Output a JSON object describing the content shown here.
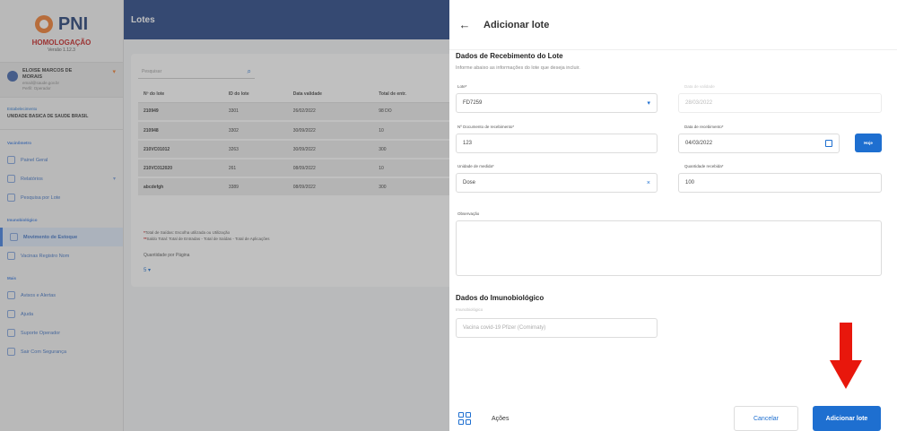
{
  "sidebar": {
    "app_name": "PNI",
    "environment": "HOMOLOGAÇÃO",
    "version": "Versão 1.12.3",
    "user": {
      "name_line1": "ELOISE MARCOS DE",
      "name_line2": "MORAIS",
      "sub_line1": "email@saude.gov.br",
      "sub_line2": "Perfil: Operador"
    },
    "establishment": {
      "label": "Estabelecimento",
      "name": "UNIDADE BASICA DE SAUDE BRASIL"
    },
    "sections": [
      {
        "title": "Vacinômetro",
        "items": [
          {
            "label": "Painel Geral",
            "icon": "chart-icon"
          },
          {
            "label": "Relatórios",
            "icon": "report-icon",
            "has_caret": true
          },
          {
            "label": "Pesquisa por Lote",
            "icon": "search-icon"
          }
        ]
      },
      {
        "title": "Imunobiológico",
        "items": [
          {
            "label": "Movimento de Estoque",
            "icon": "stock-icon",
            "active": true
          },
          {
            "label": "Vacinas Registro Nom",
            "icon": "person-icon"
          }
        ]
      },
      {
        "title": "Mais",
        "items": [
          {
            "label": "Avisos e Alertas",
            "icon": "bell-icon"
          },
          {
            "label": "Ajuda",
            "icon": "help-icon"
          },
          {
            "label": "Suporte Operador",
            "icon": "support-icon"
          },
          {
            "label": "Sair Com Segurança",
            "icon": "logout-icon"
          }
        ]
      }
    ]
  },
  "main": {
    "title": "Lotes",
    "search_placeholder": "Pesquisar",
    "columns": [
      "Nº do lote",
      "ID do lote",
      "Data validade",
      "Total de entr."
    ],
    "rows": [
      [
        "210949",
        "3301",
        "26/02/2022",
        "98 DO"
      ],
      [
        "210948",
        "3302",
        "30/09/2022",
        "10"
      ],
      [
        "210VC01012",
        "3263",
        "30/09/2022",
        "300"
      ],
      [
        "210VC012020",
        "261",
        "08/09/2022",
        "10"
      ],
      [
        "abcdefgh",
        "3389",
        "08/09/2022",
        "300"
      ]
    ],
    "note1_prefix": "*",
    "note1": "Total de Saídas: Escolha utilizada ou Utilização",
    "note2_prefix": "**",
    "note2": "Saldo Total: Total de Entradas - Total de Saídas - Total de Aplicações",
    "per_page_label": "Quantidade por Página",
    "per_page_value": "5 ▾"
  },
  "drawer": {
    "title": "Adicionar lote",
    "section1_title": "Dados de Recebimento do Lote",
    "section1_sub": "Informe abaixo as informações do lote que deseja incluir.",
    "fields": {
      "lote_label": "Lote*",
      "lote_value": "FD7259",
      "validade_label": "Data de validade",
      "validade_value": "28/03/2022",
      "documento_label": "Nº Documento de recebimento*",
      "documento_value": "123",
      "recebimento_label": "Data de recebimento*",
      "recebimento_value": "04/03/2022",
      "hoje_label": "Hoje",
      "unidade_label": "Unidade de medida*",
      "unidade_value": "Dose",
      "quantidade_label": "Quantidade recebida*",
      "quantidade_value": "100",
      "observacao_label": "Observação"
    },
    "section2_title": "Dados do Imunobiológico",
    "section2_sub": "Imunobiológico",
    "imuno_placeholder": "Vacina covid-19 Pfizer (Comirnaty)",
    "footer": {
      "acoes": "Ações",
      "cancel": "Cancelar",
      "add": "Adicionar lote"
    }
  },
  "colors": {
    "primary": "#1e6fd0",
    "topbar": "#1f3f82",
    "arrow": "#e8170c",
    "logo": "#f07a2a",
    "env": "#c41b1b"
  }
}
